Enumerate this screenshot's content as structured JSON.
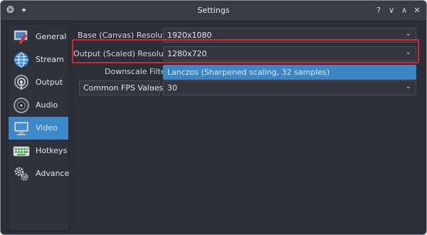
{
  "window": {
    "title": "Settings",
    "controls": [
      "?",
      "∨",
      "∧",
      "✕"
    ]
  },
  "sidebar": {
    "items": [
      {
        "label": "General",
        "icon": "general-icon",
        "active": false
      },
      {
        "label": "Stream",
        "icon": "stream-icon",
        "active": false
      },
      {
        "label": "Output",
        "icon": "output-icon",
        "active": false
      },
      {
        "label": "Audio",
        "icon": "audio-icon",
        "active": false
      },
      {
        "label": "Video",
        "icon": "video-icon",
        "active": true
      },
      {
        "label": "Hotkeys",
        "icon": "hotkeys-icon",
        "active": false
      },
      {
        "label": "Advanced",
        "icon": "advanced-icon",
        "active": false
      }
    ]
  },
  "video": {
    "base_label": "Base (Canvas) Resolution:",
    "base_value": "1920x1080",
    "output_label": "Output (Scaled) Resolution:",
    "output_value": "1280x720",
    "downscale_label": "Downscale Filter:",
    "downscale_value": "Lanczos (Sharpened scaling, 32 samples)",
    "fps_type": "Common FPS Values",
    "fps_value": "30"
  },
  "colors": {
    "accent": "#3c88c9",
    "highlight": "#d22a2a",
    "background": "#2b2e37"
  }
}
